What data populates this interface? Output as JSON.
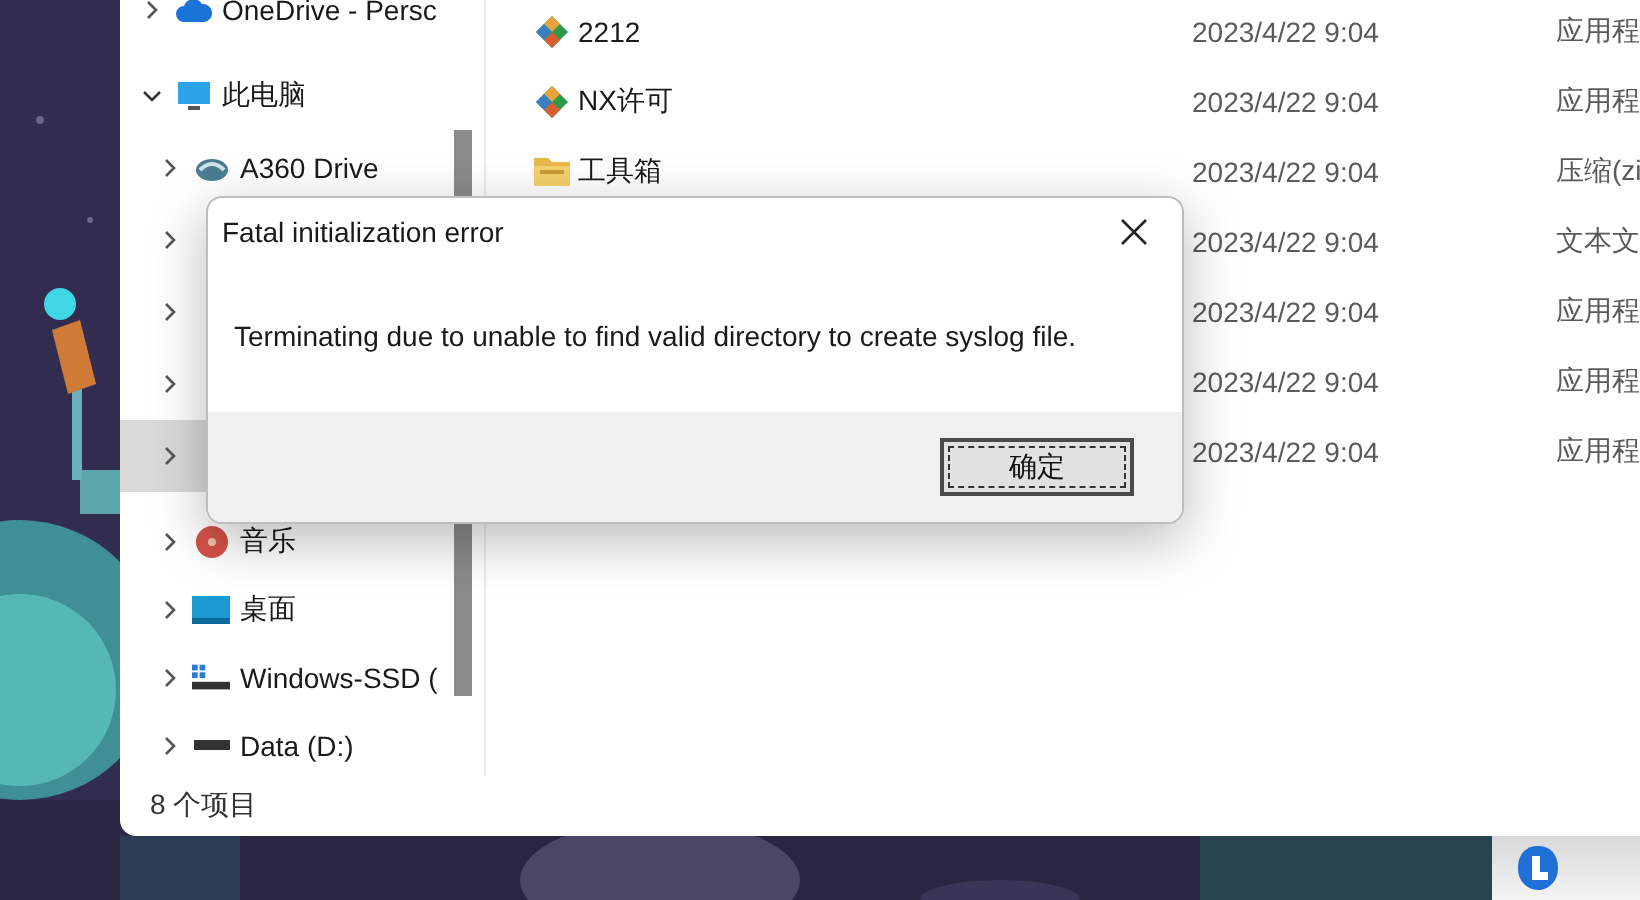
{
  "explorer": {
    "sidebar": {
      "items": [
        {
          "kind": "cloud",
          "label": "OneDrive - Persc",
          "expanded": false,
          "selected": false
        },
        {
          "kind": "pc",
          "label": "此电脑",
          "expanded": true,
          "selected": false,
          "children": [
            {
              "kind": "a360",
              "label": "A360 Drive",
              "expanded": false,
              "selected": false
            },
            {
              "kind": "covered",
              "expanded": false,
              "selected": false
            },
            {
              "kind": "covered",
              "expanded": false,
              "selected": false
            },
            {
              "kind": "covered",
              "expanded": false,
              "selected": false
            },
            {
              "kind": "covered",
              "expanded": false,
              "selected": true
            },
            {
              "kind": "music",
              "label": "音乐",
              "expanded": false,
              "selected": false
            },
            {
              "kind": "desktop",
              "label": "桌面",
              "expanded": false,
              "selected": false
            },
            {
              "kind": "ssd",
              "label": "Windows-SSD (",
              "expanded": false,
              "selected": false
            },
            {
              "kind": "disk",
              "label": "Data (D:)",
              "expanded": false,
              "selected": false
            }
          ]
        }
      ]
    },
    "files": [
      {
        "kind": "app",
        "name": "2212",
        "date": "2023/4/22 9:04",
        "type": "应用程"
      },
      {
        "kind": "app",
        "name": "NX许可",
        "date": "2023/4/22 9:04",
        "type": "应用程"
      },
      {
        "kind": "zip",
        "name": "工具箱",
        "date": "2023/4/22 9:04",
        "type": "压缩(zi"
      },
      {
        "kind": "covered",
        "date": "2023/4/22 9:04",
        "type": "文本文"
      },
      {
        "kind": "covered",
        "date": "2023/4/22 9:04",
        "type": "应用程"
      },
      {
        "kind": "covered",
        "date": "2023/4/22 9:04",
        "type": "应用程"
      },
      {
        "kind": "covered",
        "date": "2023/4/22 9:04",
        "type": "应用程"
      }
    ],
    "status_bar": "8 个项目"
  },
  "dialog": {
    "title": "Fatal initialization error",
    "message": "Terminating due to unable to find valid directory to create syslog file.",
    "buttons": [
      {
        "label": "确定",
        "default": true
      }
    ]
  }
}
